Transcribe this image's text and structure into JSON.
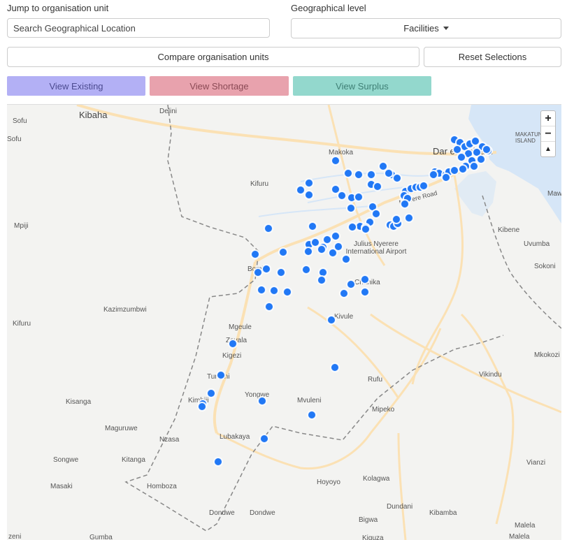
{
  "controls": {
    "jump_label": "Jump to organisation unit",
    "search_value": "Search Geographical Location",
    "geo_level_label": "Geographical level",
    "geo_level_value": "Facilities",
    "compare_button": "Compare organisation units",
    "reset_button": "Reset Selections",
    "view_existing": "View Existing",
    "view_shortage": "View Shortage",
    "view_surplus": "View Surplus"
  },
  "colors": {
    "view_existing_bg": "#b3b0f5",
    "view_shortage_bg": "#e8a2ad",
    "view_surplus_bg": "#93d8cd",
    "marker": "#2178f5",
    "water": "#d6e6f7",
    "road": "#fbe1b4"
  },
  "map": {
    "zoom_in": "+",
    "zoom_out": "−",
    "reset_north": "▲",
    "places": [
      {
        "name": "Kibaha",
        "cls": "city"
      },
      {
        "name": "Delini"
      },
      {
        "name": "Sofu"
      },
      {
        "name": "Sofu"
      },
      {
        "name": "Makoka"
      },
      {
        "name": "Dar es Salaam",
        "cls": "city"
      },
      {
        "name": "MAKATUNI ISLAND"
      },
      {
        "name": "Kifuru"
      },
      {
        "name": "Mawi"
      },
      {
        "name": "Mpiji"
      },
      {
        "name": "Nyerere Road"
      },
      {
        "name": "Kibene"
      },
      {
        "name": "Julius Nyerere International Airport"
      },
      {
        "name": "Uvumba"
      },
      {
        "name": "Bombo"
      },
      {
        "name": "Sokoni"
      },
      {
        "name": "Kazimzumbwi"
      },
      {
        "name": "Chanika"
      },
      {
        "name": "Kifuru"
      },
      {
        "name": "Mgeule"
      },
      {
        "name": "Kivule"
      },
      {
        "name": "Zavala"
      },
      {
        "name": "Kigezi"
      },
      {
        "name": "Mkokozi"
      },
      {
        "name": "Tungini"
      },
      {
        "name": "Vikindu"
      },
      {
        "name": "Rufu"
      },
      {
        "name": "Kisanga"
      },
      {
        "name": "Kimbiji"
      },
      {
        "name": "Yongwe"
      },
      {
        "name": "Mvuleni"
      },
      {
        "name": "Mipeko"
      },
      {
        "name": "Maguruwe"
      },
      {
        "name": "Nzasa"
      },
      {
        "name": "Lubakaya"
      },
      {
        "name": "Songwe"
      },
      {
        "name": "Kitanga"
      },
      {
        "name": "Vianzi"
      },
      {
        "name": "Masaki"
      },
      {
        "name": "Homboza"
      },
      {
        "name": "Hoyoyo"
      },
      {
        "name": "Kolagwa"
      },
      {
        "name": "Dundani"
      },
      {
        "name": "Dondwe"
      },
      {
        "name": "Dondwe"
      },
      {
        "name": "Kibamba"
      },
      {
        "name": "Bigwa"
      },
      {
        "name": "Malela"
      },
      {
        "name": "Malela"
      },
      {
        "name": "Gumba"
      },
      {
        "name": "Kiguza"
      },
      {
        "name": "zeni"
      }
    ]
  }
}
